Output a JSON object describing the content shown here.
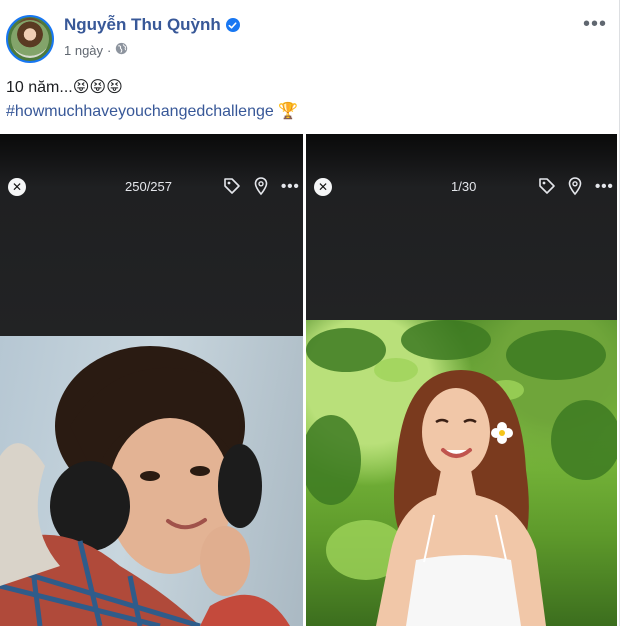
{
  "post": {
    "author_name": "Nguyễn Thu Quỳnh",
    "time": "1 ngày",
    "separator": "·",
    "text": "10 năm...😝😝😝",
    "hashtag": "#howmuchhaveyouchangedchallenge",
    "hashtag_emoji": "🏆"
  },
  "photos": [
    {
      "counter": "250/257",
      "close_glyph": "✕",
      "more_glyph": "•••"
    },
    {
      "counter": "1/30",
      "close_glyph": "✕",
      "more_glyph": "•••"
    }
  ],
  "header": {
    "more_glyph": "•••"
  },
  "icons": {
    "verified": "verified-badge-icon",
    "privacy": "globe-icon",
    "tag": "tag-icon",
    "location": "location-pin-icon",
    "trophy": "trophy-emoji"
  },
  "colors": {
    "name_blue": "#385898",
    "verified_blue": "#1877f2",
    "meta_gray": "#606770",
    "viewer_dark": "#1f2022"
  }
}
